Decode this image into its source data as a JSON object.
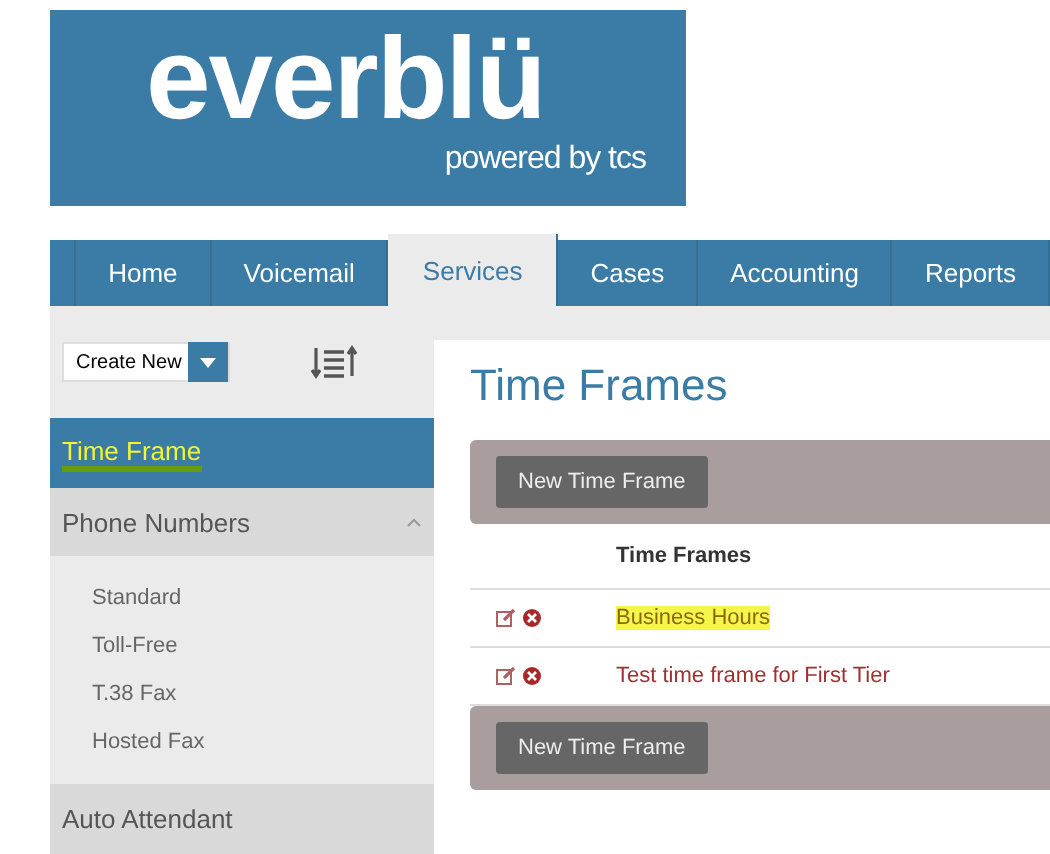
{
  "logo": {
    "name": "everblü",
    "tagline": "powered by tcs"
  },
  "nav": {
    "tabs": [
      {
        "label": "Home",
        "selected": false
      },
      {
        "label": "Voicemail",
        "selected": false
      },
      {
        "label": "Services",
        "selected": true
      },
      {
        "label": "Cases",
        "selected": false
      },
      {
        "label": "Accounting",
        "selected": false
      },
      {
        "label": "Reports",
        "selected": false
      }
    ]
  },
  "sidebar": {
    "create_select": {
      "value": "Create New"
    },
    "items": [
      {
        "kind": "link",
        "label": "Time Frame",
        "selected": true,
        "highlighted": true
      },
      {
        "kind": "group",
        "label": "Phone Numbers",
        "expanded": true,
        "children": [
          {
            "label": "Standard"
          },
          {
            "label": "Toll-Free"
          },
          {
            "label": "T.38 Fax"
          },
          {
            "label": "Hosted Fax"
          }
        ]
      },
      {
        "kind": "group",
        "label": "Auto Attendant",
        "expanded": false
      }
    ]
  },
  "main": {
    "title": "Time Frames",
    "top_button": "New Time Frame",
    "bottom_button": "New Time Frame",
    "table": {
      "columns": [
        "Time Frames"
      ],
      "rows": [
        {
          "name": "Business Hours",
          "highlighted": true
        },
        {
          "name": "Test time frame for First Tier",
          "highlighted": false
        }
      ]
    }
  }
}
